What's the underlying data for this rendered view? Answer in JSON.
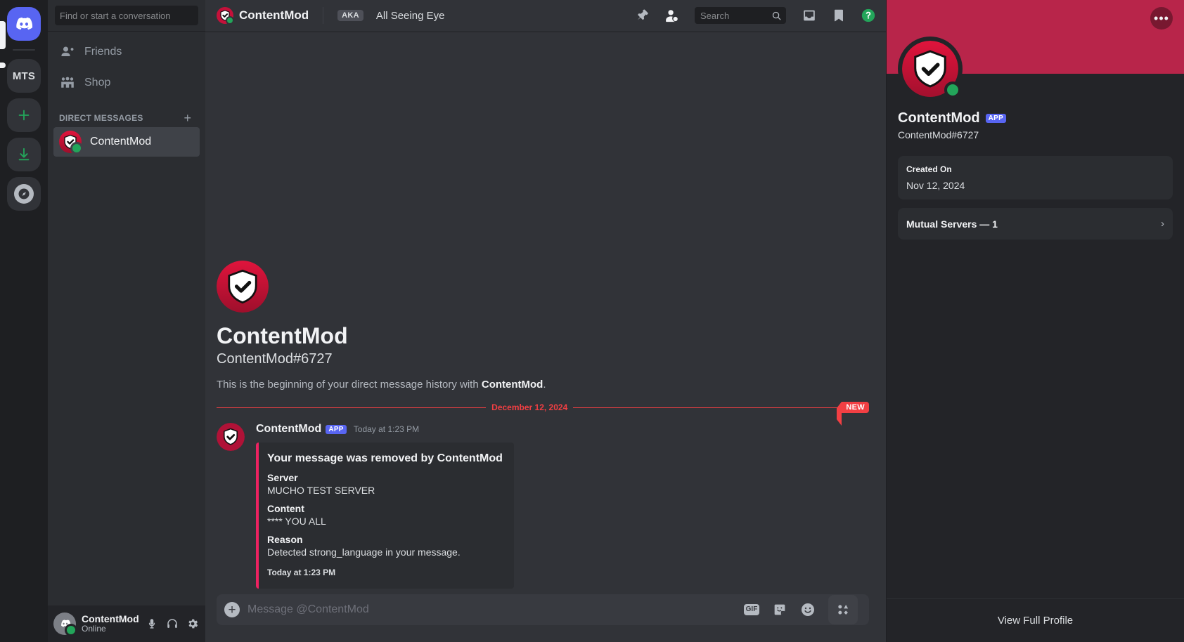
{
  "rail": {
    "home_label": "Discord",
    "servers": [
      {
        "label": "MTS",
        "name": "mts-server"
      }
    ],
    "add_server_label": "+",
    "download_label": "Download Apps",
    "discover_label": "Explore Discoverable Servers"
  },
  "sidebar": {
    "search_placeholder": "Find or start a conversation",
    "nav": [
      {
        "label": "Friends",
        "icon": "friends-icon"
      },
      {
        "label": "Shop",
        "icon": "shop-icon"
      }
    ],
    "section_title": "DIRECT MESSAGES",
    "add_dm_label": "+",
    "dms": [
      {
        "name": "ContentMod",
        "status": "online",
        "selected": true
      }
    ]
  },
  "user_panel": {
    "name": "ContentMod",
    "status": "Online",
    "mute_label": "Mute",
    "deafen_label": "Deafen",
    "settings_label": "User Settings"
  },
  "topbar": {
    "title": "ContentMod",
    "aka_badge": "AKA",
    "aka_text": "All Seeing Eye",
    "pin_label": "Pinned Messages",
    "add_friends_label": "Add Friends to DM",
    "search_placeholder": "Search",
    "inbox_label": "Inbox",
    "bookmark_label": "Saved Messages",
    "help_label": "Help"
  },
  "welcome": {
    "title": "ContentMod",
    "subtitle": "ContentMod#6727",
    "desc_prefix": "This is the beginning of your direct message history with ",
    "desc_name": "ContentMod",
    "desc_suffix": "."
  },
  "divider": {
    "date": "December 12, 2024",
    "new_badge": "NEW"
  },
  "message": {
    "author": "ContentMod",
    "app_badge": "APP",
    "timestamp": "Today at 1:23 PM",
    "embed": {
      "accent_color": "#ed2261",
      "title": "Your message was removed by ContentMod",
      "fields": [
        {
          "name": "Server",
          "value": "MUCHO TEST SERVER"
        },
        {
          "name": "Content",
          "value": "**** YOU ALL"
        },
        {
          "name": "Reason",
          "value": "Detected strong_language in your message."
        }
      ],
      "footer": "Today at 1:23 PM"
    }
  },
  "composer": {
    "placeholder": "Message @ContentMod",
    "upload_label": "+",
    "gif_label": "GIF",
    "sticker_label": "Sticker",
    "emoji_label": "Emoji",
    "apps_label": "Apps"
  },
  "profile": {
    "banner_color": "#b8254a",
    "more_label": "More",
    "name": "ContentMod",
    "app_badge": "APP",
    "tag": "ContentMod#6727",
    "created_on_label": "Created On",
    "created_on_value": "Nov 12, 2024",
    "mutual_servers_label": "Mutual Servers — 1",
    "mutual_chevron": "›",
    "view_full_profile": "View Full Profile"
  }
}
